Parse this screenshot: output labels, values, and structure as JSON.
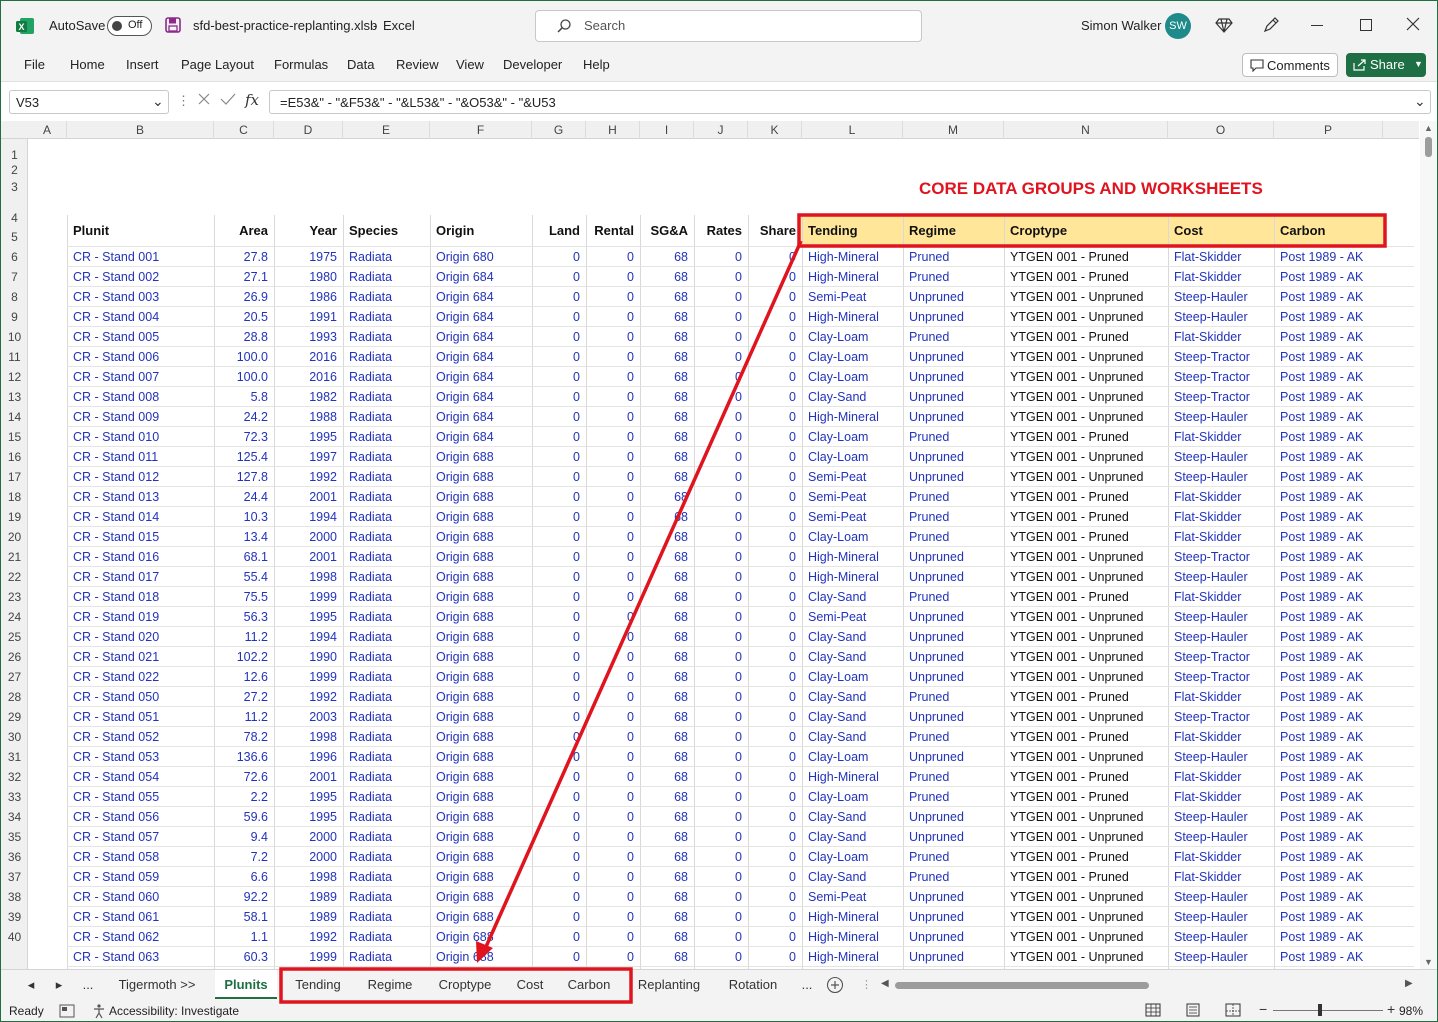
{
  "titlebar": {
    "autosave_label": "AutoSave",
    "autosave_state": "Off",
    "filename": "sfd-best-practice-replanting.xlsb",
    "app_sep": "-",
    "app_name": "Excel",
    "search_placeholder": "Search",
    "user_name": "Simon Walker",
    "user_initials": "SW"
  },
  "ribbon": {
    "menu": [
      "File",
      "Home",
      "Insert",
      "Page Layout",
      "Formulas",
      "Data",
      "Review",
      "View",
      "Developer",
      "Help"
    ],
    "comments_label": "Comments",
    "share_label": "Share"
  },
  "formula_bar": {
    "name_box": "V53",
    "formula": "=E53&\" - \"&F53&\" - \"&L53&\" - \"&O53&\" - \"&U53"
  },
  "columns": [
    "A",
    "B",
    "C",
    "D",
    "E",
    "F",
    "G",
    "H",
    "I",
    "J",
    "K",
    "L",
    "M",
    "N",
    "O",
    "P"
  ],
  "sheet": {
    "banner": "CORE DATA GROUPS AND WORKSHEETS",
    "headers": [
      "Plunit",
      "Area",
      "Year",
      "Species",
      "Origin",
      "Land",
      "Rental",
      "SG&A",
      "Rates",
      "Share",
      "Tending",
      "Regime",
      "Croptype",
      "Cost",
      "Carbon"
    ],
    "rows": [
      [
        "CR - Stand 001",
        "27.8",
        "1975",
        "Radiata",
        "Origin 680",
        "0",
        "0",
        "68",
        "0",
        "0",
        "High-Mineral",
        "Pruned",
        "YTGEN 001 - Pruned",
        "Flat-Skidder",
        "Post 1989 - AK"
      ],
      [
        "CR - Stand 002",
        "27.1",
        "1980",
        "Radiata",
        "Origin 684",
        "0",
        "0",
        "68",
        "0",
        "0",
        "High-Mineral",
        "Pruned",
        "YTGEN 001 - Pruned",
        "Flat-Skidder",
        "Post 1989 - AK"
      ],
      [
        "CR - Stand 003",
        "26.9",
        "1986",
        "Radiata",
        "Origin 684",
        "0",
        "0",
        "68",
        "0",
        "0",
        "Semi-Peat",
        "Unpruned",
        "YTGEN 001 - Unpruned",
        "Steep-Hauler",
        "Post 1989 - AK"
      ],
      [
        "CR - Stand 004",
        "20.5",
        "1991",
        "Radiata",
        "Origin 684",
        "0",
        "0",
        "68",
        "0",
        "0",
        "High-Mineral",
        "Unpruned",
        "YTGEN 001 - Unpruned",
        "Steep-Hauler",
        "Post 1989 - AK"
      ],
      [
        "CR - Stand 005",
        "28.8",
        "1993",
        "Radiata",
        "Origin 684",
        "0",
        "0",
        "68",
        "0",
        "0",
        "Clay-Loam",
        "Pruned",
        "YTGEN 001 - Pruned",
        "Flat-Skidder",
        "Post 1989 - AK"
      ],
      [
        "CR - Stand 006",
        "100.0",
        "2016",
        "Radiata",
        "Origin 684",
        "0",
        "0",
        "68",
        "0",
        "0",
        "Clay-Loam",
        "Unpruned",
        "YTGEN 001 - Unpruned",
        "Steep-Tractor",
        "Post 1989 - AK"
      ],
      [
        "CR - Stand 007",
        "100.0",
        "2016",
        "Radiata",
        "Origin 684",
        "0",
        "0",
        "68",
        "0",
        "0",
        "Clay-Loam",
        "Unpruned",
        "YTGEN 001 - Unpruned",
        "Steep-Tractor",
        "Post 1989 - AK"
      ],
      [
        "CR - Stand 008",
        "5.8",
        "1982",
        "Radiata",
        "Origin 684",
        "0",
        "0",
        "68",
        "0",
        "0",
        "Clay-Sand",
        "Unpruned",
        "YTGEN 001 - Unpruned",
        "Steep-Tractor",
        "Post 1989 - AK"
      ],
      [
        "CR - Stand 009",
        "24.2",
        "1988",
        "Radiata",
        "Origin 684",
        "0",
        "0",
        "68",
        "0",
        "0",
        "High-Mineral",
        "Unpruned",
        "YTGEN 001 - Unpruned",
        "Steep-Hauler",
        "Post 1989 - AK"
      ],
      [
        "CR - Stand 010",
        "72.3",
        "1995",
        "Radiata",
        "Origin 684",
        "0",
        "0",
        "68",
        "0",
        "0",
        "Clay-Loam",
        "Pruned",
        "YTGEN 001 - Pruned",
        "Flat-Skidder",
        "Post 1989 - AK"
      ],
      [
        "CR - Stand 011",
        "125.4",
        "1997",
        "Radiata",
        "Origin 688",
        "0",
        "0",
        "68",
        "0",
        "0",
        "Clay-Loam",
        "Unpruned",
        "YTGEN 001 - Unpruned",
        "Steep-Hauler",
        "Post 1989 - AK"
      ],
      [
        "CR - Stand 012",
        "127.8",
        "1992",
        "Radiata",
        "Origin 688",
        "0",
        "0",
        "68",
        "0",
        "0",
        "Semi-Peat",
        "Unpruned",
        "YTGEN 001 - Unpruned",
        "Steep-Hauler",
        "Post 1989 - AK"
      ],
      [
        "CR - Stand 013",
        "24.4",
        "2001",
        "Radiata",
        "Origin 688",
        "0",
        "0",
        "68",
        "0",
        "0",
        "Semi-Peat",
        "Pruned",
        "YTGEN 001 - Pruned",
        "Flat-Skidder",
        "Post 1989 - AK"
      ],
      [
        "CR - Stand 014",
        "10.3",
        "1994",
        "Radiata",
        "Origin 688",
        "0",
        "0",
        "68",
        "0",
        "0",
        "Semi-Peat",
        "Pruned",
        "YTGEN 001 - Pruned",
        "Flat-Skidder",
        "Post 1989 - AK"
      ],
      [
        "CR - Stand 015",
        "13.4",
        "2000",
        "Radiata",
        "Origin 688",
        "0",
        "0",
        "68",
        "0",
        "0",
        "Clay-Loam",
        "Pruned",
        "YTGEN 001 - Pruned",
        "Flat-Skidder",
        "Post 1989 - AK"
      ],
      [
        "CR - Stand 016",
        "68.1",
        "2001",
        "Radiata",
        "Origin 688",
        "0",
        "0",
        "68",
        "0",
        "0",
        "High-Mineral",
        "Unpruned",
        "YTGEN 001 - Unpruned",
        "Steep-Tractor",
        "Post 1989 - AK"
      ],
      [
        "CR - Stand 017",
        "55.4",
        "1998",
        "Radiata",
        "Origin 688",
        "0",
        "0",
        "68",
        "0",
        "0",
        "High-Mineral",
        "Unpruned",
        "YTGEN 001 - Unpruned",
        "Steep-Hauler",
        "Post 1989 - AK"
      ],
      [
        "CR - Stand 018",
        "75.5",
        "1999",
        "Radiata",
        "Origin 688",
        "0",
        "0",
        "68",
        "0",
        "0",
        "Clay-Sand",
        "Pruned",
        "YTGEN 001 - Pruned",
        "Flat-Skidder",
        "Post 1989 - AK"
      ],
      [
        "CR - Stand 019",
        "56.3",
        "1995",
        "Radiata",
        "Origin 688",
        "0",
        "0",
        "68",
        "0",
        "0",
        "Semi-Peat",
        "Unpruned",
        "YTGEN 001 - Unpruned",
        "Steep-Hauler",
        "Post 1989 - AK"
      ],
      [
        "CR - Stand 020",
        "11.2",
        "1994",
        "Radiata",
        "Origin 688",
        "0",
        "0",
        "68",
        "0",
        "0",
        "Clay-Sand",
        "Unpruned",
        "YTGEN 001 - Unpruned",
        "Steep-Hauler",
        "Post 1989 - AK"
      ],
      [
        "CR - Stand 021",
        "102.2",
        "1990",
        "Radiata",
        "Origin 688",
        "0",
        "0",
        "68",
        "0",
        "0",
        "Clay-Sand",
        "Unpruned",
        "YTGEN 001 - Unpruned",
        "Steep-Tractor",
        "Post 1989 - AK"
      ],
      [
        "CR - Stand 022",
        "12.6",
        "1999",
        "Radiata",
        "Origin 688",
        "0",
        "0",
        "68",
        "0",
        "0",
        "Clay-Loam",
        "Unpruned",
        "YTGEN 001 - Unpruned",
        "Steep-Tractor",
        "Post 1989 - AK"
      ],
      [
        "CR - Stand 050",
        "27.2",
        "1992",
        "Radiata",
        "Origin 688",
        "0",
        "0",
        "68",
        "0",
        "0",
        "Clay-Sand",
        "Pruned",
        "YTGEN 001 - Pruned",
        "Flat-Skidder",
        "Post 1989 - AK"
      ],
      [
        "CR - Stand 051",
        "11.2",
        "2003",
        "Radiata",
        "Origin 688",
        "0",
        "0",
        "68",
        "0",
        "0",
        "Clay-Sand",
        "Unpruned",
        "YTGEN 001 - Unpruned",
        "Steep-Tractor",
        "Post 1989 - AK"
      ],
      [
        "CR - Stand 052",
        "78.2",
        "1998",
        "Radiata",
        "Origin 688",
        "0",
        "0",
        "68",
        "0",
        "0",
        "Clay-Sand",
        "Pruned",
        "YTGEN 001 - Pruned",
        "Flat-Skidder",
        "Post 1989 - AK"
      ],
      [
        "CR - Stand 053",
        "136.6",
        "1996",
        "Radiata",
        "Origin 688",
        "0",
        "0",
        "68",
        "0",
        "0",
        "Clay-Loam",
        "Unpruned",
        "YTGEN 001 - Unpruned",
        "Steep-Hauler",
        "Post 1989 - AK"
      ],
      [
        "CR - Stand 054",
        "72.6",
        "2001",
        "Radiata",
        "Origin 688",
        "0",
        "0",
        "68",
        "0",
        "0",
        "High-Mineral",
        "Pruned",
        "YTGEN 001 - Pruned",
        "Flat-Skidder",
        "Post 1989 - AK"
      ],
      [
        "CR - Stand 055",
        "2.2",
        "1995",
        "Radiata",
        "Origin 688",
        "0",
        "0",
        "68",
        "0",
        "0",
        "Clay-Loam",
        "Pruned",
        "YTGEN 001 - Pruned",
        "Flat-Skidder",
        "Post 1989 - AK"
      ],
      [
        "CR - Stand 056",
        "59.6",
        "1995",
        "Radiata",
        "Origin 688",
        "0",
        "0",
        "68",
        "0",
        "0",
        "Clay-Sand",
        "Unpruned",
        "YTGEN 001 - Unpruned",
        "Steep-Hauler",
        "Post 1989 - AK"
      ],
      [
        "CR - Stand 057",
        "9.4",
        "2000",
        "Radiata",
        "Origin 688",
        "0",
        "0",
        "68",
        "0",
        "0",
        "Clay-Sand",
        "Unpruned",
        "YTGEN 001 - Unpruned",
        "Steep-Hauler",
        "Post 1989 - AK"
      ],
      [
        "CR - Stand 058",
        "7.2",
        "2000",
        "Radiata",
        "Origin 688",
        "0",
        "0",
        "68",
        "0",
        "0",
        "Clay-Loam",
        "Pruned",
        "YTGEN 001 - Pruned",
        "Flat-Skidder",
        "Post 1989 - AK"
      ],
      [
        "CR - Stand 059",
        "6.6",
        "1998",
        "Radiata",
        "Origin 688",
        "0",
        "0",
        "68",
        "0",
        "0",
        "Clay-Sand",
        "Pruned",
        "YTGEN 001 - Pruned",
        "Flat-Skidder",
        "Post 1989 - AK"
      ],
      [
        "CR - Stand 060",
        "92.2",
        "1989",
        "Radiata",
        "Origin 688",
        "0",
        "0",
        "68",
        "0",
        "0",
        "Semi-Peat",
        "Unpruned",
        "YTGEN 001 - Unpruned",
        "Steep-Hauler",
        "Post 1989 - AK"
      ],
      [
        "CR - Stand 061",
        "58.1",
        "1989",
        "Radiata",
        "Origin 688",
        "0",
        "0",
        "68",
        "0",
        "0",
        "High-Mineral",
        "Unpruned",
        "YTGEN 001 - Unpruned",
        "Steep-Hauler",
        "Post 1989 - AK"
      ],
      [
        "CR - Stand 062",
        "1.1",
        "1992",
        "Radiata",
        "Origin 688",
        "0",
        "0",
        "68",
        "0",
        "0",
        "High-Mineral",
        "Unpruned",
        "YTGEN 001 - Unpruned",
        "Steep-Hauler",
        "Post 1989 - AK"
      ],
      [
        "CR - Stand 063",
        "60.3",
        "1999",
        "Radiata",
        "Origin 688",
        "0",
        "0",
        "68",
        "0",
        "0",
        "High-Mineral",
        "Unpruned",
        "YTGEN 001 - Unpruned",
        "Steep-Hauler",
        "Post 1989 - AK"
      ]
    ]
  },
  "tabs": {
    "ellipsis": "...",
    "items": [
      "Tigermoth >>",
      "Plunits",
      "Tending",
      "Regime",
      "Croptype",
      "Cost",
      "Carbon",
      "Replanting",
      "Rotation"
    ],
    "active": "Plunits"
  },
  "statusbar": {
    "ready": "Ready",
    "accessibility": "Accessibility: Investigate",
    "zoom": "98%"
  },
  "colors": {
    "excel_green": "#1e6f43",
    "highlight_red": "#e0141e",
    "header_fill": "#ffe699",
    "data_blue": "#2233bb"
  }
}
